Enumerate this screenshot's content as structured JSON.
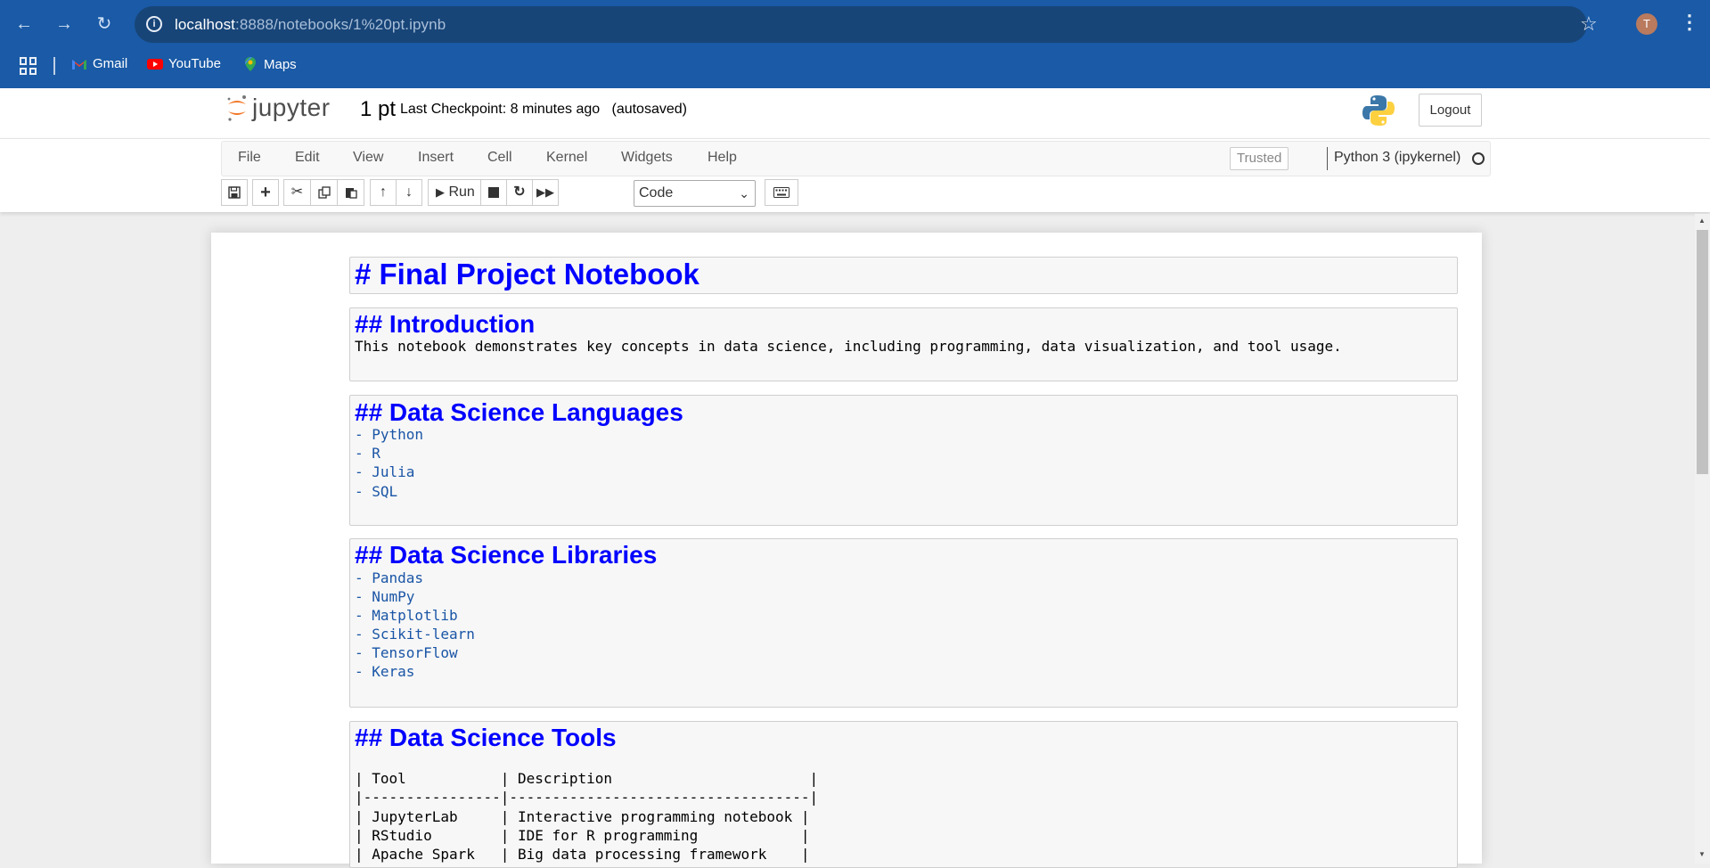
{
  "browser": {
    "url_host": "localhost",
    "url_path": ":8888/notebooks/1%20pt.ipynb",
    "profile_initial": "T",
    "bookmarks": [
      {
        "label": "Gmail",
        "icon": "gmail-icon",
        "color": "#ea4335"
      },
      {
        "label": "YouTube",
        "icon": "youtube-icon",
        "color": "#ff0000"
      },
      {
        "label": "Maps",
        "icon": "maps-icon",
        "color": "#34a853"
      }
    ]
  },
  "jupyter": {
    "logo_text": "jupyter",
    "notebook_title": "1 pt",
    "checkpoint": "Last Checkpoint: 8 minutes ago",
    "autosaved": "(autosaved)",
    "logout_label": "Logout",
    "menu": [
      "File",
      "Edit",
      "View",
      "Insert",
      "Cell",
      "Kernel",
      "Widgets",
      "Help"
    ],
    "trusted_label": "Trusted",
    "kernel_name": "Python 3 (ipykernel)",
    "toolbar": {
      "run_label": "Run",
      "cell_type": "Code"
    }
  },
  "cells": [
    {
      "heading": "# Final Project Notebook",
      "level": 1
    },
    {
      "heading": "## Introduction",
      "level": 2,
      "text": "This notebook demonstrates key concepts in data science, including programming, data visualization, and tool usage."
    },
    {
      "heading": "## Data Science Languages",
      "level": 2,
      "items": [
        "- Python",
        "- R",
        "- Julia",
        "- SQL"
      ]
    },
    {
      "heading": "## Data Science Libraries",
      "level": 2,
      "items": [
        "- Pandas",
        "- NumPy",
        "- Matplotlib",
        "- Scikit-learn",
        "- TensorFlow",
        "- Keras"
      ]
    },
    {
      "heading": "## Data Science Tools",
      "level": 2,
      "table_lines": [
        "| Tool           | Description                       |",
        "|----------------|-----------------------------------|",
        "| JupyterLab     | Interactive programming notebook |",
        "| RStudio        | IDE for R programming            |",
        "| Apache Spark   | Big data processing framework    |"
      ]
    }
  ],
  "colors": {
    "browser_bar": "#1a5aa6",
    "heading": "#0000ff",
    "list_item": "#1a55a6"
  }
}
